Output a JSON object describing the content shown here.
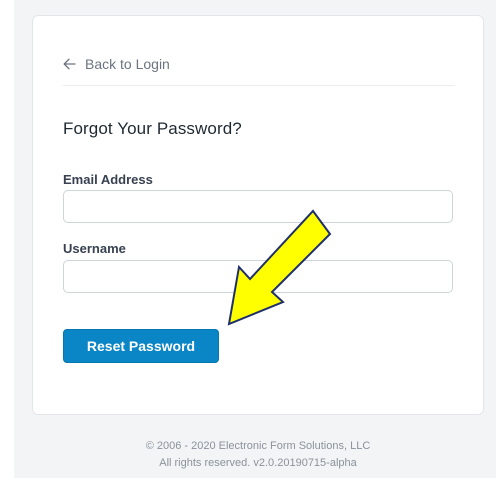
{
  "colors": {
    "accent": "#0a85c5",
    "annotation_fill": "#ffff00",
    "annotation_stroke": "#1f2f6b"
  },
  "back_link": {
    "icon": "arrow-left-icon",
    "label": "Back to Login"
  },
  "form": {
    "title": "Forgot Your Password?",
    "email": {
      "label": "Email Address",
      "value": "",
      "placeholder": ""
    },
    "username": {
      "label": "Username",
      "value": "",
      "placeholder": ""
    },
    "submit_label": "Reset Password"
  },
  "footer": {
    "copyright": "© 2006 - 2020 Electronic Form Solutions, LLC",
    "rights": "All rights reserved. v2.0.20190715-alpha"
  },
  "annotation": {
    "icon": "yellow-arrow-icon"
  }
}
